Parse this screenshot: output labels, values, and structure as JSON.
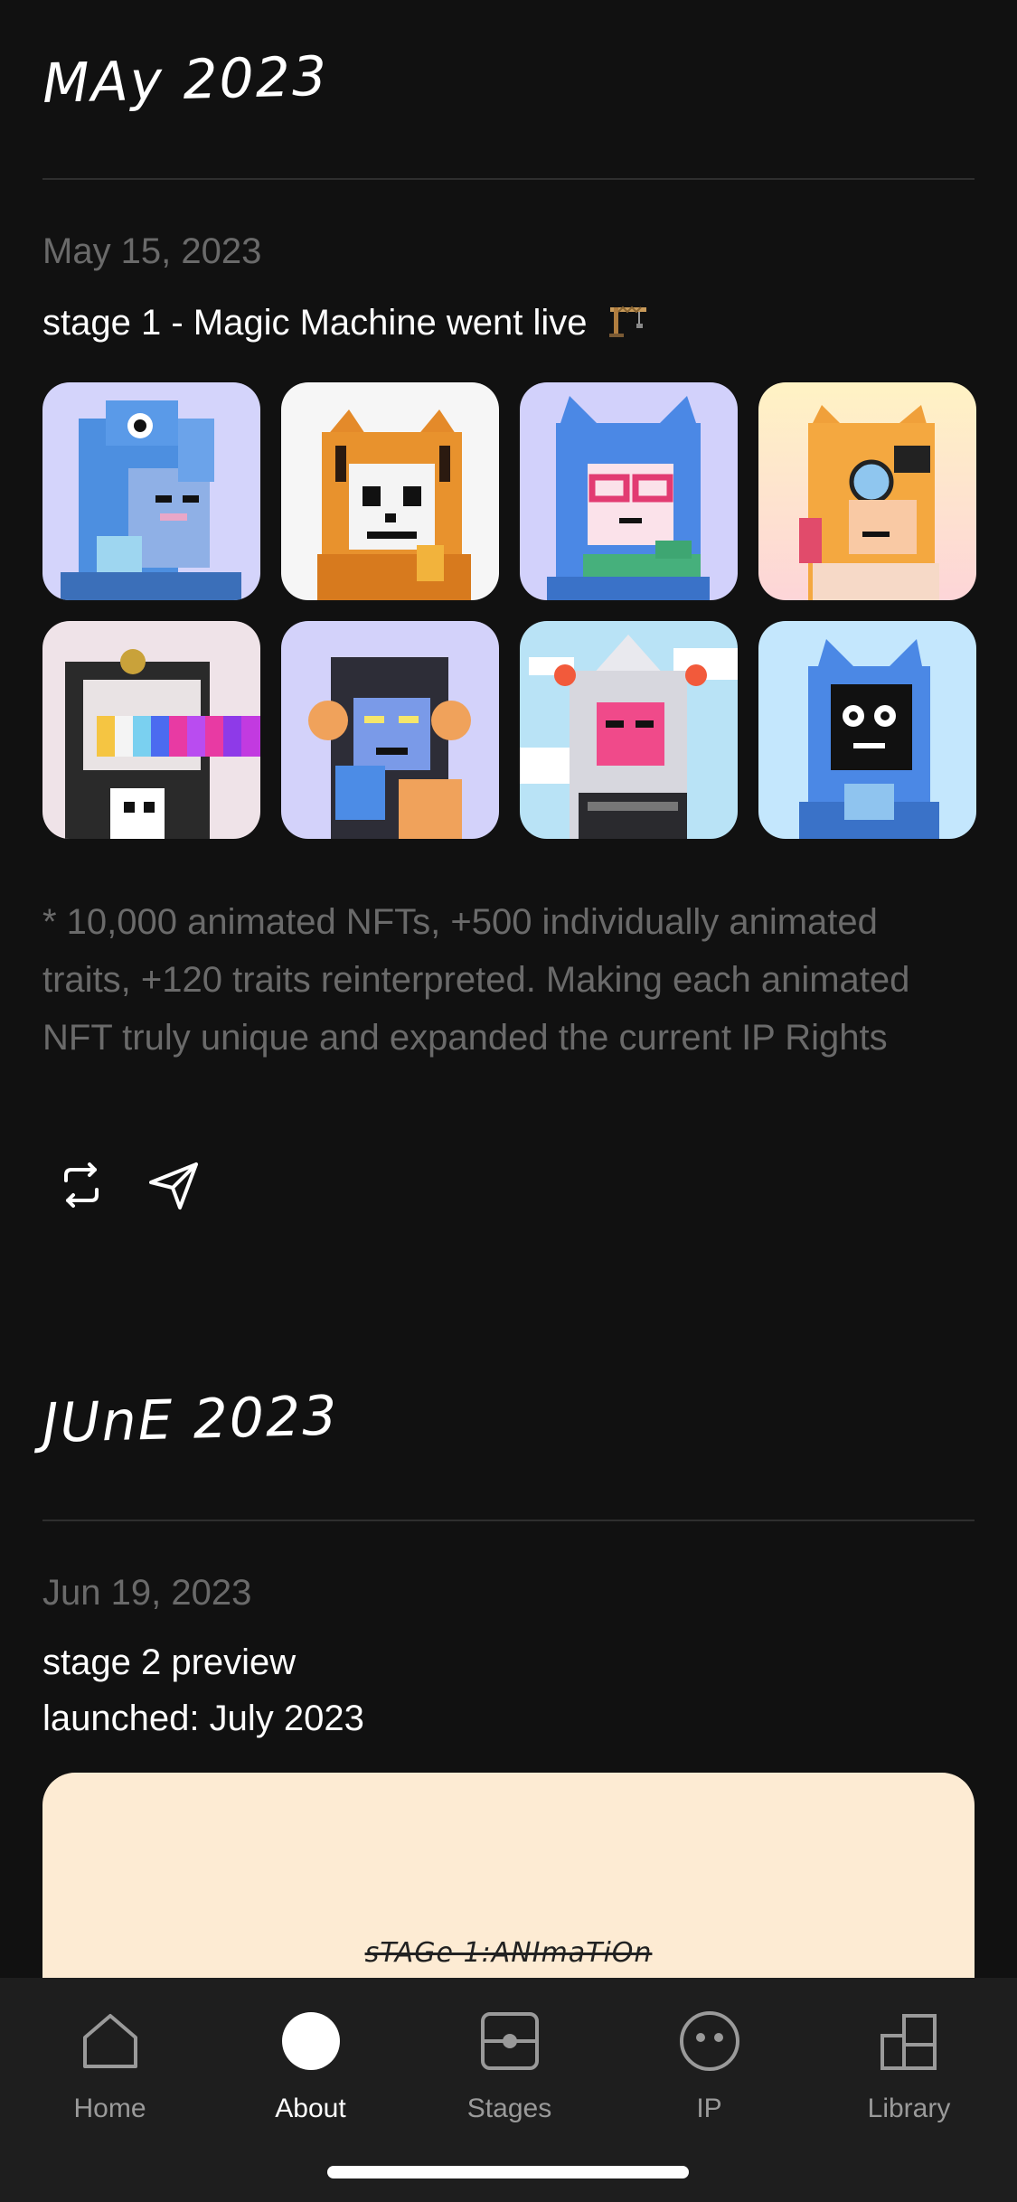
{
  "sections": [
    {
      "month": "MAy 2023",
      "posts": [
        {
          "date": "May 15, 2023",
          "title": "stage 1 - Magic Machine went live",
          "title_icon": "construction-crane-icon",
          "description": "* 10,000 animated NFTs, +500 individually animated traits, +120 traits reinterpreted. Making each animated NFT truly unique and expanded the current IP Rights",
          "images": [
            {
              "name": "nft-blue-fish-hood",
              "bg": "#d4d4fb"
            },
            {
              "name": "nft-tiger-skull",
              "bg": "#f6f6f6"
            },
            {
              "name": "nft-blue-cat-glasses",
              "bg": "#d2d1fb"
            },
            {
              "name": "nft-shiba-monocle",
              "bg": "#fde9c5"
            },
            {
              "name": "nft-astronaut-rainbow",
              "bg": "#efe3e8"
            },
            {
              "name": "nft-monkey",
              "bg": "#d3d2fa"
            },
            {
              "name": "nft-shark-sky",
              "bg": "#b9e3f6"
            },
            {
              "name": "nft-blue-cat-black-face",
              "bg": "#c4e7fd"
            }
          ],
          "actions": [
            {
              "name": "repost-icon"
            },
            {
              "name": "share-icon"
            }
          ]
        }
      ]
    },
    {
      "month": "JUnE 2023",
      "posts": [
        {
          "date": "Jun 19, 2023",
          "title_lines": [
            "stage 2 preview",
            "launched: July 2023"
          ],
          "preview_label": "sTAGe 1:ANImaTiOn",
          "preview_bg": "#fdebd3"
        }
      ]
    }
  ],
  "tabbar": {
    "tabs": [
      {
        "label": "Home",
        "icon": "home-icon",
        "active": false
      },
      {
        "label": "About",
        "icon": "about-circle-icon",
        "active": true
      },
      {
        "label": "Stages",
        "icon": "stages-icon",
        "active": false
      },
      {
        "label": "IP",
        "icon": "ip-face-icon",
        "active": false
      },
      {
        "label": "Library",
        "icon": "library-icon",
        "active": false
      }
    ]
  },
  "colors": {
    "background": "#111111",
    "muted_text": "#6a6a6a",
    "tabbar_bg": "#1e1e1e",
    "tab_inactive": "#9a9a9a",
    "tab_active": "#ffffff"
  }
}
